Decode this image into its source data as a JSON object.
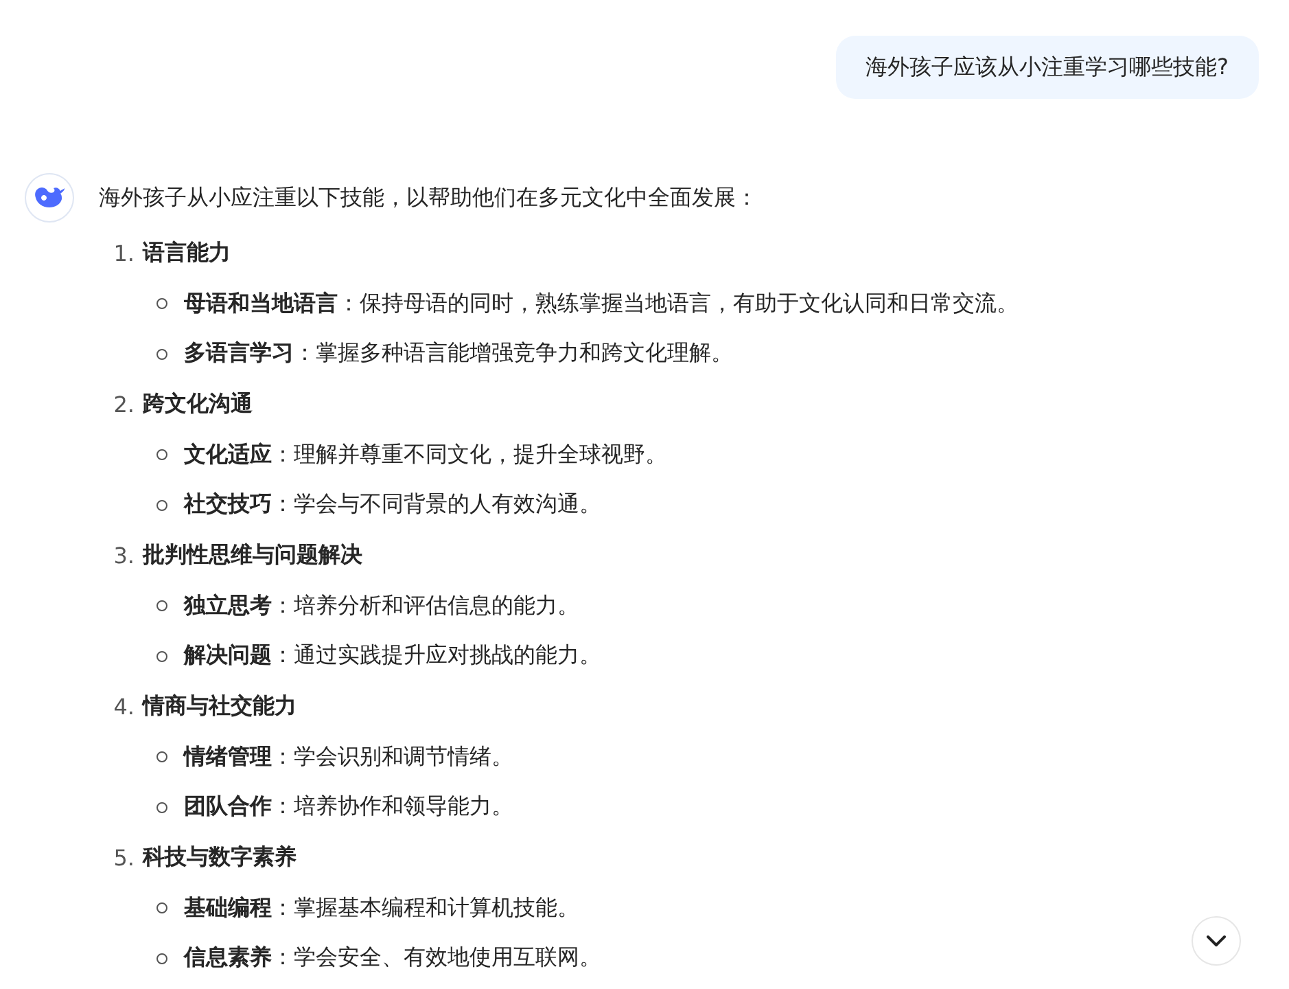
{
  "user_message": "海外孩子应该从小注重学习哪些技能?",
  "reply": {
    "intro": "海外孩子从小应注重以下技能，以帮助他们在多元文化中全面发展：",
    "sections": [
      {
        "number": "1.",
        "title": "语言能力",
        "points": [
          "**母语和当地语言**：保持母语的同时，熟练掌握当地语言，有助于文化认同和日常交流。",
          "**多语言学习**：掌握多种语言能增强竞争力和跨文化理解。"
        ]
      },
      {
        "number": "2.",
        "title": "跨文化沟通",
        "points": [
          "**文化适应**：理解并尊重不同文化，提升全球视野。",
          "**社交技巧**：学会与不同背景的人有效沟通。"
        ]
      },
      {
        "number": "3.",
        "title": "批判性思维与问题解决",
        "points": [
          "**独立思考**：培养分析和评估信息的能力。",
          "**解决问题**：通过实践提升应对挑战的能力。"
        ]
      },
      {
        "number": "4.",
        "title": "情商与社交能力",
        "points": [
          "**情绪管理**：学会识别和调节情绪。",
          "**团队合作**：培养协作和领导能力。"
        ]
      },
      {
        "number": "5.",
        "title": "科技与数字素养",
        "points": [
          "**基础编程**：掌握基本编程和计算机技能。",
          "**信息素养**：学会安全、有效地使用互联网。"
        ]
      }
    ]
  }
}
